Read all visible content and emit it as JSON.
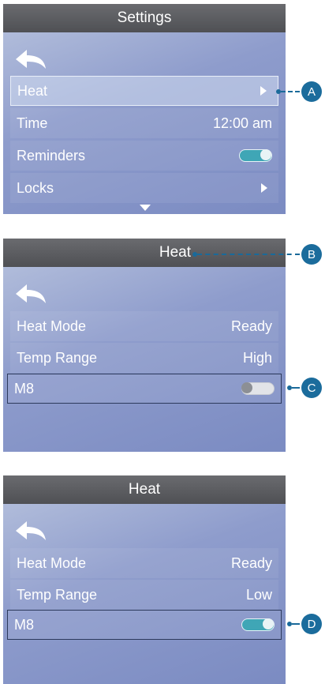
{
  "screen1": {
    "title": "Settings",
    "rows": [
      {
        "label": "Heat",
        "value": ""
      },
      {
        "label": "Time",
        "value": "12:00 am"
      },
      {
        "label": "Reminders",
        "value": ""
      },
      {
        "label": "Locks",
        "value": ""
      }
    ],
    "reminders_toggle": "on"
  },
  "screen2": {
    "title": "Heat",
    "rows": [
      {
        "label": "Heat Mode",
        "value": "Ready"
      },
      {
        "label": "Temp Range",
        "value": "High"
      },
      {
        "label": "M8",
        "value": ""
      }
    ],
    "m8_toggle": "off"
  },
  "screen3": {
    "title": "Heat",
    "rows": [
      {
        "label": "Heat Mode",
        "value": "Ready"
      },
      {
        "label": "Temp Range",
        "value": "Low"
      },
      {
        "label": "M8",
        "value": ""
      }
    ],
    "m8_toggle": "on"
  },
  "callouts": [
    "A",
    "B",
    "C",
    "D"
  ],
  "icons": [
    "back-arrow-icon",
    "right-arrow-icon",
    "down-arrow-icon",
    "toggle-switch"
  ],
  "colors": {
    "titlebar": "#58595d",
    "callout": "#1b6c9c",
    "toggle_on": "#3fa6b6"
  }
}
